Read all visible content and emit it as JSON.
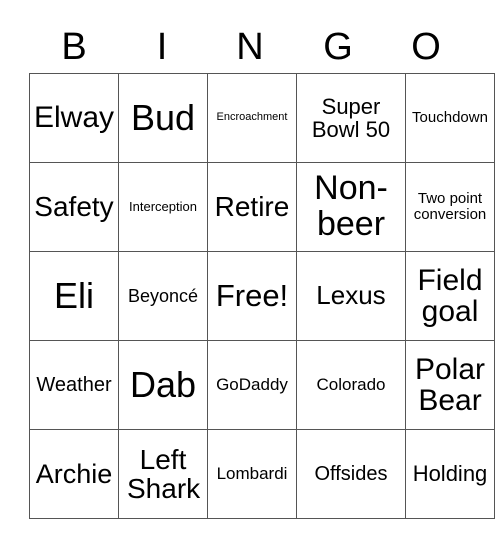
{
  "header": [
    "B",
    "I",
    "N",
    "G",
    "O"
  ],
  "rows": [
    [
      "Elway",
      "Bud",
      "Encroachment",
      "Super Bowl 50",
      "Touchdown"
    ],
    [
      "Safety",
      "Interception",
      "Retire",
      "Non-beer",
      "Two point conversion"
    ],
    [
      "Eli",
      "Beyoncé",
      "Free!",
      "Lexus",
      "Field goal"
    ],
    [
      "Weather",
      "Dab",
      "GoDaddy",
      "Colorado",
      "Polar Bear"
    ],
    [
      "Archie",
      "Left Shark",
      "Lombardi",
      "Offsides",
      "Holding"
    ]
  ]
}
